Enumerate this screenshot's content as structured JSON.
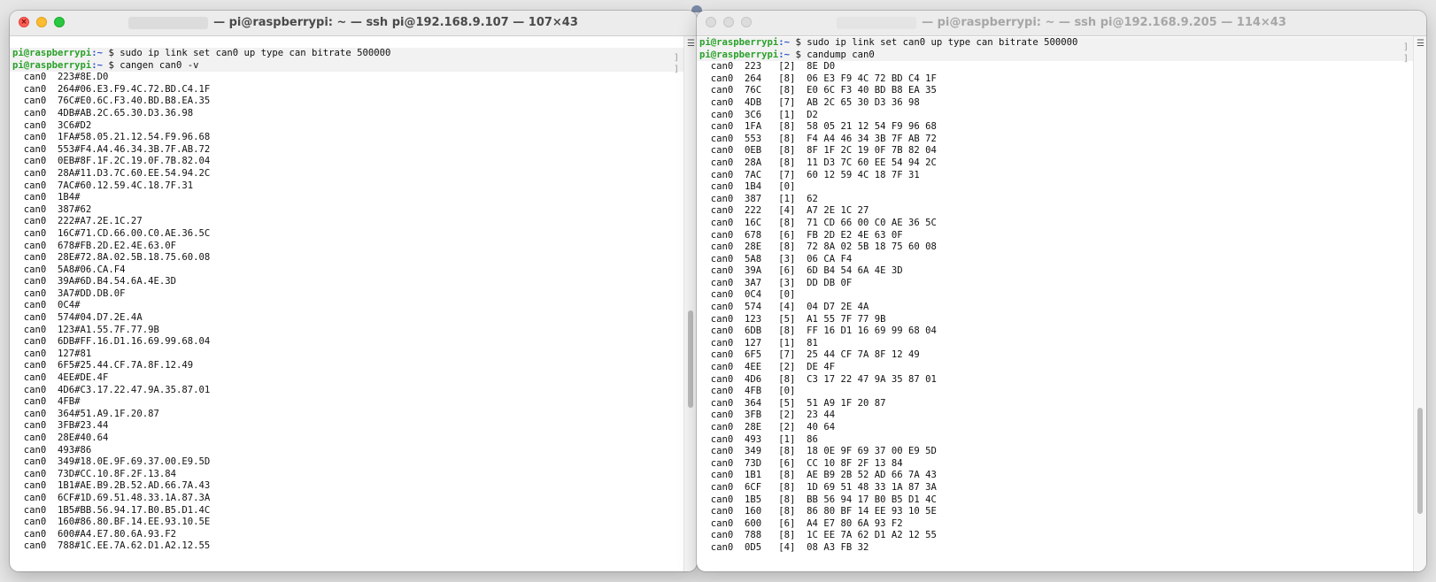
{
  "left": {
    "title": "— pi@raspberrypi: ~ — ssh pi@192.168.9.107 — 107×43",
    "lines": [
      {
        "prompt": true,
        "user": "pi@raspberrypi",
        "path": ":~",
        "cmd": " $ sudo ip link set can0 up type can bitrate 500000"
      },
      {
        "prompt": true,
        "user": "pi@raspberrypi",
        "path": ":~",
        "cmd": " $ cangen can0 -v"
      },
      {
        "text": "  can0  223#8E.D0"
      },
      {
        "text": "  can0  264#06.E3.F9.4C.72.BD.C4.1F"
      },
      {
        "text": "  can0  76C#E0.6C.F3.40.BD.B8.EA.35"
      },
      {
        "text": "  can0  4DB#AB.2C.65.30.D3.36.98"
      },
      {
        "text": "  can0  3C6#D2"
      },
      {
        "text": "  can0  1FA#58.05.21.12.54.F9.96.68"
      },
      {
        "text": "  can0  553#F4.A4.46.34.3B.7F.AB.72"
      },
      {
        "text": "  can0  0EB#8F.1F.2C.19.0F.7B.82.04"
      },
      {
        "text": "  can0  28A#11.D3.7C.60.EE.54.94.2C"
      },
      {
        "text": "  can0  7AC#60.12.59.4C.18.7F.31"
      },
      {
        "text": "  can0  1B4#"
      },
      {
        "text": "  can0  387#62"
      },
      {
        "text": "  can0  222#A7.2E.1C.27"
      },
      {
        "text": "  can0  16C#71.CD.66.00.C0.AE.36.5C"
      },
      {
        "text": "  can0  678#FB.2D.E2.4E.63.0F"
      },
      {
        "text": "  can0  28E#72.8A.02.5B.18.75.60.08"
      },
      {
        "text": "  can0  5A8#06.CA.F4"
      },
      {
        "text": "  can0  39A#6D.B4.54.6A.4E.3D"
      },
      {
        "text": "  can0  3A7#DD.DB.0F"
      },
      {
        "text": "  can0  0C4#"
      },
      {
        "text": "  can0  574#04.D7.2E.4A"
      },
      {
        "text": "  can0  123#A1.55.7F.77.9B"
      },
      {
        "text": "  can0  6DB#FF.16.D1.16.69.99.68.04"
      },
      {
        "text": "  can0  127#81"
      },
      {
        "text": "  can0  6F5#25.44.CF.7A.8F.12.49"
      },
      {
        "text": "  can0  4EE#DE.4F"
      },
      {
        "text": "  can0  4D6#C3.17.22.47.9A.35.87.01"
      },
      {
        "text": "  can0  4FB#"
      },
      {
        "text": "  can0  364#51.A9.1F.20.87"
      },
      {
        "text": "  can0  3FB#23.44"
      },
      {
        "text": "  can0  28E#40.64"
      },
      {
        "text": "  can0  493#86"
      },
      {
        "text": "  can0  349#18.0E.9F.69.37.00.E9.5D"
      },
      {
        "text": "  can0  73D#CC.10.8F.2F.13.84"
      },
      {
        "text": "  can0  1B1#AE.B9.2B.52.AD.66.7A.43"
      },
      {
        "text": "  can0  6CF#1D.69.51.48.33.1A.87.3A"
      },
      {
        "text": "  can0  1B5#BB.56.94.17.B0.B5.D1.4C"
      },
      {
        "text": "  can0  160#86.80.BF.14.EE.93.10.5E"
      },
      {
        "text": "  can0  600#A4.E7.80.6A.93.F2"
      },
      {
        "text": "  can0  788#1C.EE.7A.62.D1.A2.12.55"
      }
    ]
  },
  "right": {
    "title": "— pi@raspberrypi: ~ — ssh pi@192.168.9.205 — 114×43",
    "lines": [
      {
        "prompt": true,
        "user": "pi@raspberrypi",
        "path": ":~",
        "cmd": " $ sudo ip link set can0 up type can bitrate 500000"
      },
      {
        "prompt": true,
        "user": "pi@raspberrypi",
        "path": ":~",
        "cmd": " $ candump can0"
      },
      {
        "text": "  can0  223   [2]  8E D0"
      },
      {
        "text": "  can0  264   [8]  06 E3 F9 4C 72 BD C4 1F"
      },
      {
        "text": "  can0  76C   [8]  E0 6C F3 40 BD B8 EA 35"
      },
      {
        "text": "  can0  4DB   [7]  AB 2C 65 30 D3 36 98"
      },
      {
        "text": "  can0  3C6   [1]  D2"
      },
      {
        "text": "  can0  1FA   [8]  58 05 21 12 54 F9 96 68"
      },
      {
        "text": "  can0  553   [8]  F4 A4 46 34 3B 7F AB 72"
      },
      {
        "text": "  can0  0EB   [8]  8F 1F 2C 19 0F 7B 82 04"
      },
      {
        "text": "  can0  28A   [8]  11 D3 7C 60 EE 54 94 2C"
      },
      {
        "text": "  can0  7AC   [7]  60 12 59 4C 18 7F 31"
      },
      {
        "text": "  can0  1B4   [0]"
      },
      {
        "text": "  can0  387   [1]  62"
      },
      {
        "text": "  can0  222   [4]  A7 2E 1C 27"
      },
      {
        "text": "  can0  16C   [8]  71 CD 66 00 C0 AE 36 5C"
      },
      {
        "text": "  can0  678   [6]  FB 2D E2 4E 63 0F"
      },
      {
        "text": "  can0  28E   [8]  72 8A 02 5B 18 75 60 08"
      },
      {
        "text": "  can0  5A8   [3]  06 CA F4"
      },
      {
        "text": "  can0  39A   [6]  6D B4 54 6A 4E 3D"
      },
      {
        "text": "  can0  3A7   [3]  DD DB 0F"
      },
      {
        "text": "  can0  0C4   [0]"
      },
      {
        "text": "  can0  574   [4]  04 D7 2E 4A"
      },
      {
        "text": "  can0  123   [5]  A1 55 7F 77 9B"
      },
      {
        "text": "  can0  6DB   [8]  FF 16 D1 16 69 99 68 04"
      },
      {
        "text": "  can0  127   [1]  81"
      },
      {
        "text": "  can0  6F5   [7]  25 44 CF 7A 8F 12 49"
      },
      {
        "text": "  can0  4EE   [2]  DE 4F"
      },
      {
        "text": "  can0  4D6   [8]  C3 17 22 47 9A 35 87 01"
      },
      {
        "text": "  can0  4FB   [0]"
      },
      {
        "text": "  can0  364   [5]  51 A9 1F 20 87"
      },
      {
        "text": "  can0  3FB   [2]  23 44"
      },
      {
        "text": "  can0  28E   [2]  40 64"
      },
      {
        "text": "  can0  493   [1]  86"
      },
      {
        "text": "  can0  349   [8]  18 0E 9F 69 37 00 E9 5D"
      },
      {
        "text": "  can0  73D   [6]  CC 10 8F 2F 13 84"
      },
      {
        "text": "  can0  1B1   [8]  AE B9 2B 52 AD 66 7A 43"
      },
      {
        "text": "  can0  6CF   [8]  1D 69 51 48 33 1A 87 3A"
      },
      {
        "text": "  can0  1B5   [8]  BB 56 94 17 B0 B5 D1 4C"
      },
      {
        "text": "  can0  160   [8]  86 80 BF 14 EE 93 10 5E"
      },
      {
        "text": "  can0  600   [6]  A4 E7 80 6A 93 F2"
      },
      {
        "text": "  can0  788   [8]  1C EE 7A 62 D1 A2 12 55"
      },
      {
        "text": "  can0  0D5   [4]  08 A3 FB 32"
      }
    ]
  },
  "icons": {
    "close": "close-icon",
    "minimize": "minimize-icon",
    "zoom": "zoom-icon",
    "scroll_menu": "list-icon"
  },
  "colors": {
    "prompt_user": "#2aa12a",
    "prompt_path": "#2a55c9",
    "close": "#fe5f57",
    "minimize": "#febc2e",
    "zoom": "#28c840"
  }
}
